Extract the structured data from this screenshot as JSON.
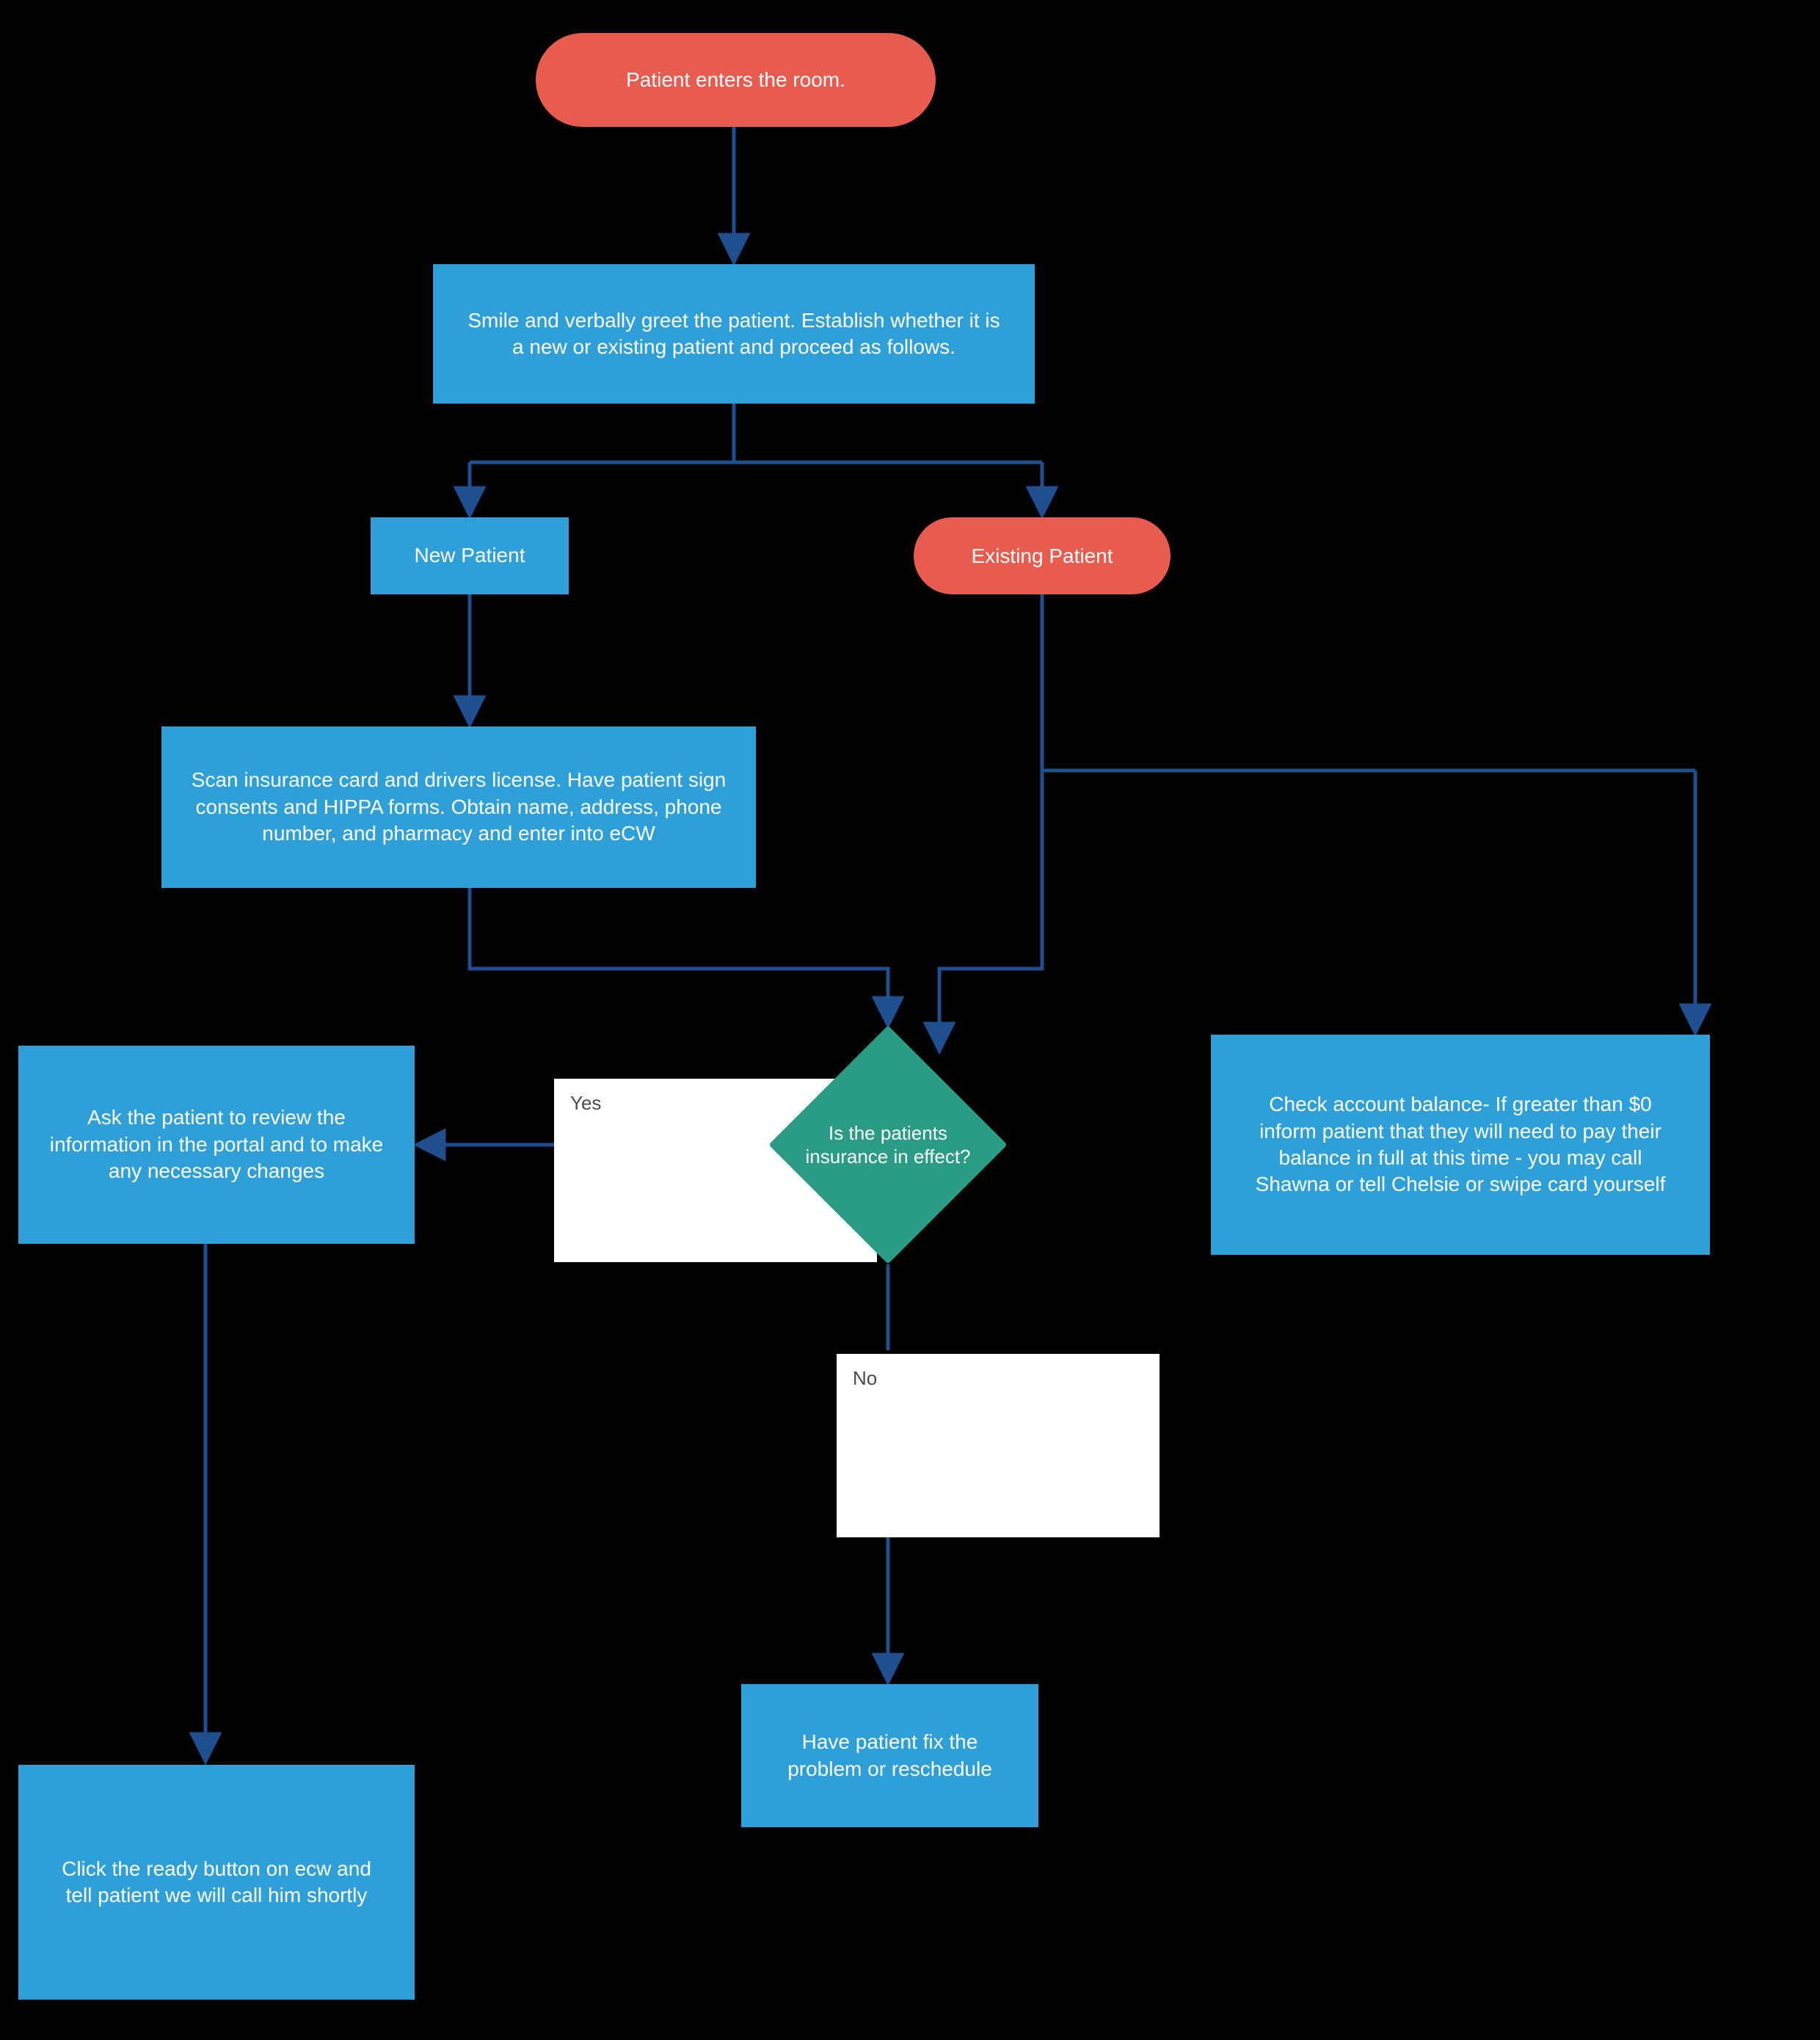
{
  "flow": {
    "start": "Patient enters the room.",
    "greet": "Smile and verbally greet the patient. Establish whether it is a new or existing patient and proceed as follows.",
    "new_patient": "New Patient",
    "existing_patient": "Existing Patient",
    "new_patient_scan": "Scan insurance card and drivers license. Have patient sign consents and HIPPA forms. Obtain name, address, phone number, and pharmacy and enter into eCW",
    "decision": "Is the patients insurance in effect?",
    "yes_label": "Yes",
    "no_label": "No",
    "review_info": "Ask the patient to review the information in the portal and to make any necessary changes",
    "click_ready": "Click the ready button on ecw and tell patient we will call him shortly",
    "fix_reschedule": "Have patient fix the problem or reschedule",
    "check_balance": "Check account balance- If greater than $0 inform patient that they will need to pay their balance in full at this time - you may call Shawna or tell Chelsie or swipe card yourself"
  },
  "chart_data": {
    "type": "flowchart",
    "title": "Patient intake workflow",
    "nodes": [
      {
        "id": "start",
        "shape": "terminator",
        "text": "Patient enters the room."
      },
      {
        "id": "greet",
        "shape": "process",
        "text": "Smile and verbally greet the patient. Establish whether it is a new or existing patient and proceed as follows."
      },
      {
        "id": "new_patient",
        "shape": "process",
        "text": "New Patient"
      },
      {
        "id": "existing_patient",
        "shape": "terminator",
        "text": "Existing Patient"
      },
      {
        "id": "scan",
        "shape": "process",
        "text": "Scan insurance card and drivers license. Have patient sign consents and HIPPA forms. Obtain name, address, phone number, and pharmacy and enter into eCW"
      },
      {
        "id": "decision",
        "shape": "decision",
        "text": "Is the patients insurance in effect?"
      },
      {
        "id": "review",
        "shape": "process",
        "text": "Ask the patient to review the information in the portal and to make any necessary changes"
      },
      {
        "id": "ready",
        "shape": "process",
        "text": "Click the ready button on ecw and tell patient we will call him shortly"
      },
      {
        "id": "fix",
        "shape": "process",
        "text": "Have patient fix the problem or reschedule"
      },
      {
        "id": "balance",
        "shape": "process",
        "text": "Check account balance- If greater than $0 inform patient that they will need to pay their balance in full at this time - you may call Shawna or tell Chelsie or swipe card yourself"
      }
    ],
    "edges": [
      {
        "from": "start",
        "to": "greet"
      },
      {
        "from": "greet",
        "to": "new_patient"
      },
      {
        "from": "greet",
        "to": "existing_patient"
      },
      {
        "from": "new_patient",
        "to": "scan"
      },
      {
        "from": "scan",
        "to": "decision"
      },
      {
        "from": "existing_patient",
        "to": "decision"
      },
      {
        "from": "existing_patient",
        "to": "balance"
      },
      {
        "from": "decision",
        "to": "review",
        "label": "Yes"
      },
      {
        "from": "decision",
        "to": "fix",
        "label": "No"
      },
      {
        "from": "review",
        "to": "ready"
      }
    ]
  }
}
